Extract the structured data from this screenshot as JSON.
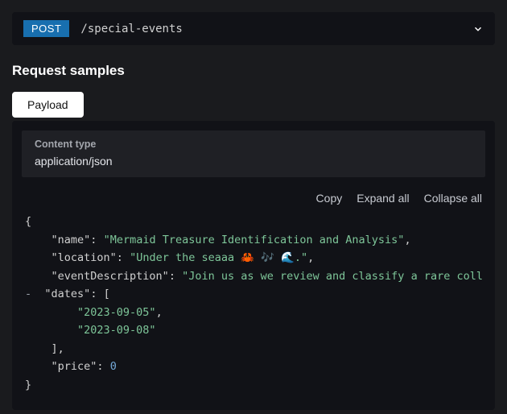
{
  "endpoint": {
    "method": "POST",
    "path": "/special-events"
  },
  "section_title": "Request samples",
  "tabs": {
    "payload": "Payload"
  },
  "content_type": {
    "label": "Content type",
    "value": "application/json"
  },
  "actions": {
    "copy": "Copy",
    "expand": "Expand all",
    "collapse": "Collapse all"
  },
  "payload": {
    "keys": {
      "name": "\"name\"",
      "location": "\"location\"",
      "eventDescription": "\"eventDescription\"",
      "dates": "\"dates\"",
      "price": "\"price\""
    },
    "values": {
      "name": "\"Mermaid Treasure Identification and Analysis\"",
      "location": "\"Under the seaaa 🦀 🎶 🌊.\"",
      "eventDescription": "\"Join us as we review and classify a rare coll",
      "date0": "\"2023-09-05\"",
      "date1": "\"2023-09-08\"",
      "price": "0"
    }
  }
}
